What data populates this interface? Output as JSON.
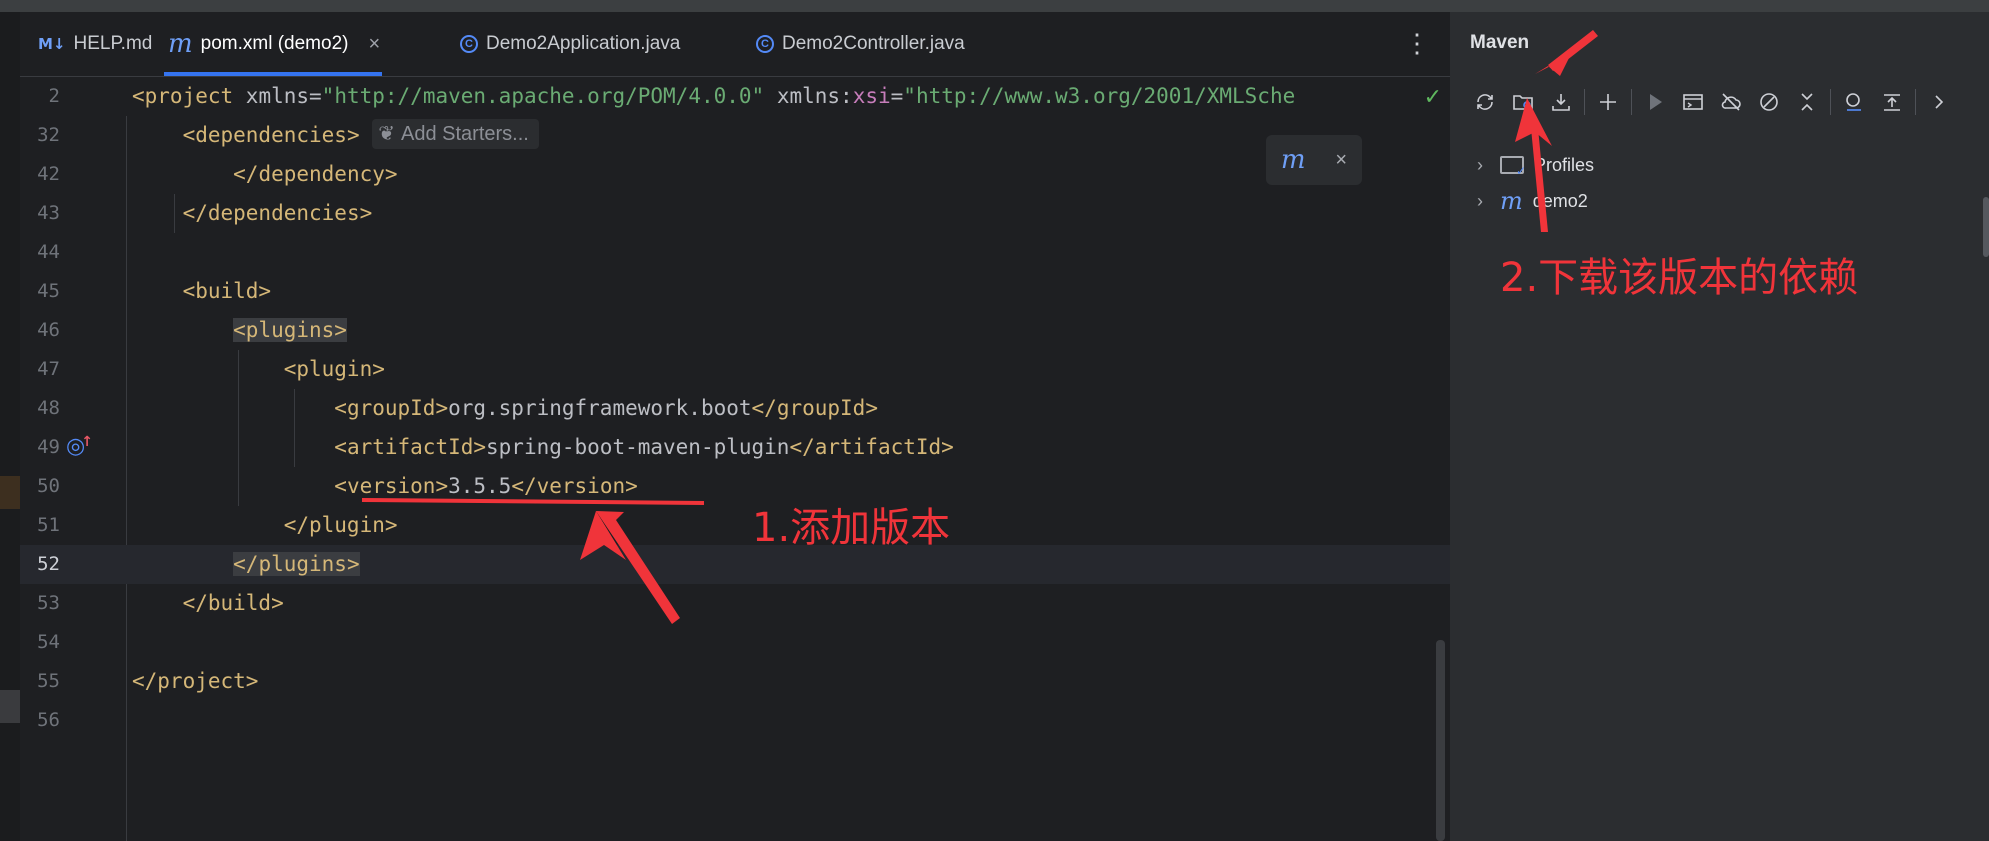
{
  "tabs": [
    {
      "icon": "markdown-icon",
      "glyph": "M↓",
      "label": "HELP.md",
      "active": false
    },
    {
      "icon": "maven-pom-icon",
      "glyph": "m",
      "label": "pom.xml (demo2)",
      "active": true,
      "close": "×"
    },
    {
      "icon": "spring-boot-class-icon",
      "glyph": "C",
      "label": "Demo2Application.java",
      "active": false
    },
    {
      "icon": "class-icon",
      "glyph": "C",
      "label": "Demo2Controller.java",
      "active": false
    }
  ],
  "tab_more_glyph": "⋮",
  "editor": {
    "add_starters_label": "Add Starters...",
    "reload_close": "×",
    "lines": [
      {
        "num": "2",
        "segments": [
          [
            "tag",
            "<project "
          ],
          [
            "attr",
            "xmlns"
          ],
          [
            "txt",
            "="
          ],
          [
            "str",
            "\"http://maven.apache.org/POM/4.0.0\""
          ],
          [
            "txt",
            " "
          ],
          [
            "attr",
            "xmlns:"
          ],
          [
            "ns",
            "xsi"
          ],
          [
            "txt",
            "="
          ],
          [
            "str",
            "\"http://www.w3.org/2001/XMLSche"
          ]
        ]
      },
      {
        "num": "32",
        "segments": [
          [
            "txt",
            "    "
          ],
          [
            "tag",
            "<dependencies>"
          ]
        ]
      },
      {
        "num": "42",
        "segments": [
          [
            "txt",
            "        "
          ],
          [
            "tag",
            "</dependency>"
          ]
        ]
      },
      {
        "num": "43",
        "segments": [
          [
            "txt",
            "    "
          ],
          [
            "tag",
            "</dependencies>"
          ]
        ]
      },
      {
        "num": "44",
        "segments": []
      },
      {
        "num": "45",
        "segments": [
          [
            "txt",
            "    "
          ],
          [
            "tag",
            "<build>"
          ]
        ]
      },
      {
        "num": "46",
        "segments": [
          [
            "txt",
            "        "
          ],
          [
            "tag-hl",
            "<plugins>"
          ]
        ]
      },
      {
        "num": "47",
        "segments": [
          [
            "txt",
            "            "
          ],
          [
            "tag",
            "<plugin>"
          ]
        ]
      },
      {
        "num": "48",
        "segments": [
          [
            "txt",
            "                "
          ],
          [
            "tag",
            "<groupId>"
          ],
          [
            "txt",
            "org.springframework.boot"
          ],
          [
            "tag",
            "</groupId>"
          ]
        ]
      },
      {
        "num": "49",
        "segments": [
          [
            "txt",
            "                "
          ],
          [
            "tag",
            "<artifactId>"
          ],
          [
            "txt",
            "spring-boot-maven-plugin"
          ],
          [
            "tag",
            "</artifactId>"
          ]
        ]
      },
      {
        "num": "50",
        "segments": [
          [
            "txt",
            "                "
          ],
          [
            "tag",
            "<version>"
          ],
          [
            "txt",
            "3.5.5"
          ],
          [
            "tag",
            "</version>"
          ]
        ]
      },
      {
        "num": "51",
        "segments": [
          [
            "txt",
            "            "
          ],
          [
            "tag",
            "</plugin>"
          ]
        ]
      },
      {
        "num": "52",
        "segments": [
          [
            "txt",
            "        "
          ],
          [
            "tag-hl",
            "</plugins>"
          ]
        ]
      },
      {
        "num": "53",
        "segments": [
          [
            "txt",
            "    "
          ],
          [
            "tag",
            "</build>"
          ]
        ]
      },
      {
        "num": "54",
        "segments": []
      },
      {
        "num": "55",
        "segments": [
          [
            "tag",
            "</project>"
          ]
        ]
      },
      {
        "num": "56",
        "segments": []
      }
    ]
  },
  "maven": {
    "title": "Maven",
    "toolbar": [
      {
        "name": "reload-all-icon"
      },
      {
        "name": "reload-project-icon"
      },
      {
        "name": "download-sources-icon"
      },
      {
        "sep": true
      },
      {
        "name": "add-project-icon"
      },
      {
        "sep": true
      },
      {
        "name": "run-icon",
        "dim": true
      },
      {
        "name": "execute-goal-icon"
      },
      {
        "name": "offline-mode-icon"
      },
      {
        "name": "skip-tests-icon"
      },
      {
        "name": "collapse-all-icon"
      },
      {
        "sep": true
      },
      {
        "name": "analyze-dependencies-icon"
      },
      {
        "name": "show-settings-icon"
      },
      {
        "sep": true
      },
      {
        "name": "more-icon"
      }
    ],
    "tree": [
      {
        "label": "Profiles",
        "icon": "folder-icon"
      },
      {
        "label": "demo2",
        "icon": "maven-module-icon"
      }
    ]
  },
  "annotations": {
    "step1": "1.添加版本",
    "step2": "2.下载该版本的依赖"
  },
  "colors": {
    "accent": "#3574f0",
    "annotation": "#f0343a",
    "tag": "#d5b778",
    "string": "#6aab73"
  }
}
